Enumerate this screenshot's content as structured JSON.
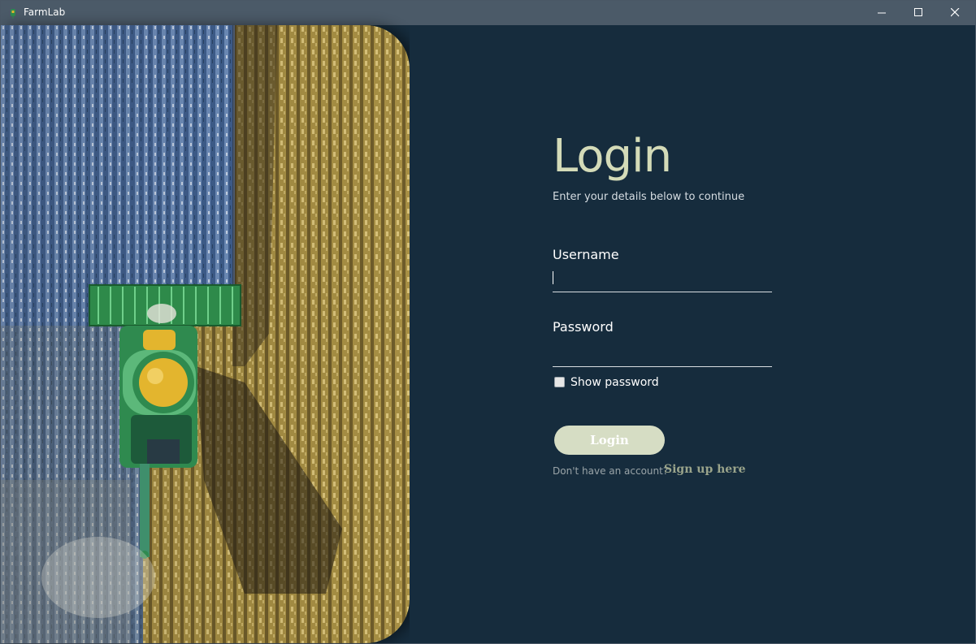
{
  "window": {
    "title": "FarmLab",
    "controls": [
      "minimize-icon",
      "maximize-icon",
      "close-icon"
    ]
  },
  "hero": {
    "description": "aerial photo of a combine harvester in a field",
    "colors": {
      "field_blue": "#4a6fa8",
      "field_gold": "#b49a4a",
      "tractor_green": "#2f8a4f",
      "grain": "#e3b52e"
    }
  },
  "login": {
    "title": "Login",
    "subtitle": "Enter your details below to continue",
    "username_label": "Username",
    "username_value": "",
    "password_label": "Password",
    "password_value": "",
    "show_password_label": "Show password",
    "show_password_checked": false,
    "button_label": "Login",
    "no_account_text": "Don't have an account?",
    "signup_link": "Sign up here"
  },
  "colors": {
    "background": "#162c3d",
    "titlebar": "#4b5a68",
    "accent": "#d4dbb8",
    "button": "#d6ddc4",
    "link": "#9aa48b"
  }
}
